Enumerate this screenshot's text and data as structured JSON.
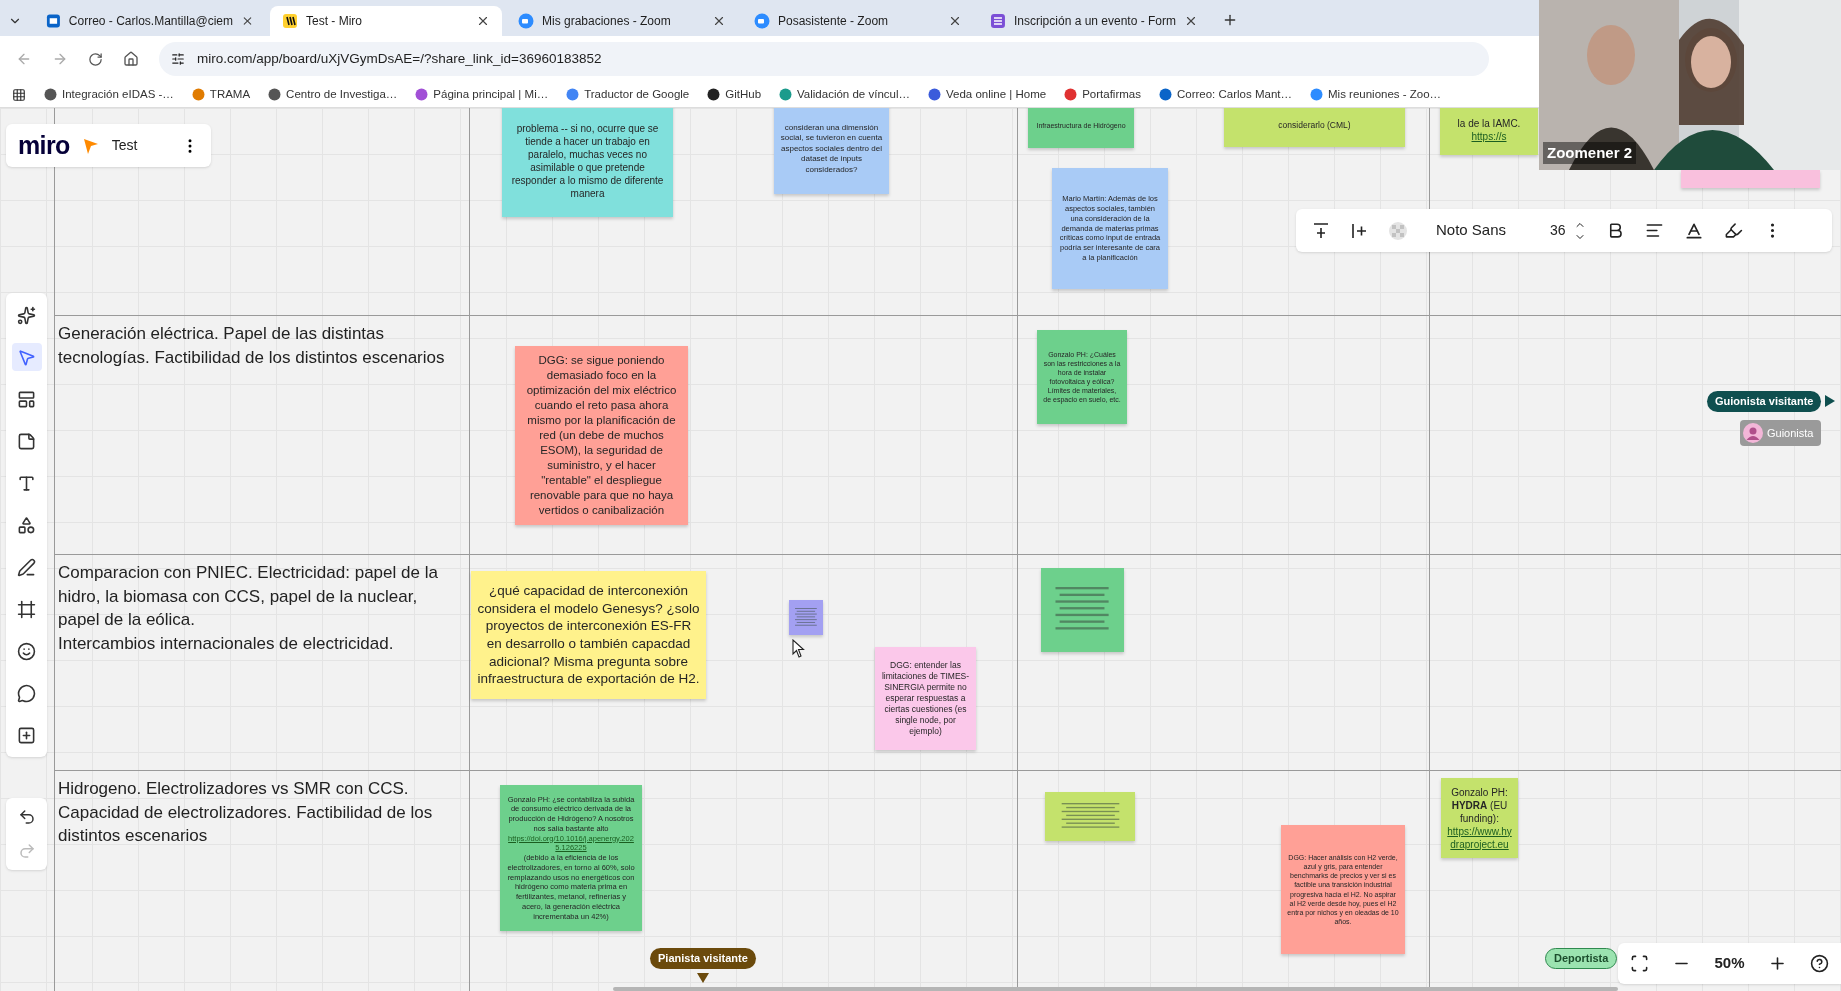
{
  "browser": {
    "tabs": [
      {
        "title": "Correo - Carlos.Mantilla@ciem",
        "kind": "mail",
        "selected": false
      },
      {
        "title": "Test - Miro",
        "kind": "miro",
        "selected": true
      },
      {
        "title": "Mis grabaciones - Zoom",
        "kind": "zoom",
        "selected": false
      },
      {
        "title": "Posasistente - Zoom",
        "kind": "zoom",
        "selected": false
      },
      {
        "title": "Inscripción a un evento - Form",
        "kind": "forms",
        "selected": false
      }
    ],
    "address": "miro.com/app/board/uXjVGymDsAE=/?share_link_id=36960183852",
    "bookmarks": [
      "Integración eIDAS -…",
      "TRAMA",
      "Centro de Investiga…",
      "Página principal | Mi…",
      "Traductor de Google",
      "GitHub",
      "Validación de víncul…",
      "Veda online | Home",
      "Portafirmas",
      "Correo: Carlos Mant…",
      "Mis reuniones - Zoo…"
    ]
  },
  "board": {
    "logo": "miro",
    "name": "Test",
    "rows": [
      {
        "label": "Generación eléctrica. Papel de las distintas tecnologías. Factibilidad de los distintos escenarios"
      },
      {
        "label": "Comparacion con PNIEC. Electricidad: papel de la hidro, la biomasa con CCS, papel de la nuclear, papel de la eólica.\nIntercambios internacionales de electricidad."
      },
      {
        "label": "Hidrogeno. Electrolizadores vs SMR con CCS. Capacidad de electrolizadores. Factibilidad de los distintos escenarios"
      }
    ],
    "notes": [
      {
        "kind": "text",
        "color": "#80e0dc",
        "text": "problema -- si no, ocurre que se tiende a hacer un trabajo en paralelo, muchas veces no asimilable o que pretende responder a lo mismo de diferente manera"
      },
      {
        "kind": "text",
        "color": "#a9cbf6",
        "text": "consideran una dimensión social, se tuvieron en cuenta aspectos sociales dentro del dataset de inputs considerados?"
      },
      {
        "kind": "text",
        "color": "#6dd08c",
        "text": "Infraestructura de Hidrógeno"
      },
      {
        "kind": "text",
        "color": "#a9cbf6",
        "text": "Mario Martín: Además de los aspectos sociales, también una consideración de la demanda de materias primas críticas como input de entrada podría ser interesante de cara a la planificación"
      },
      {
        "kind": "text",
        "color": "#c4e26c",
        "text": "considerarlo (CML)"
      },
      {
        "kind": "text",
        "color": "#c4e26c",
        "text": "la de la IAMC.",
        "link": "https://s"
      },
      {
        "kind": "blank",
        "color": "#f9c0dd"
      },
      {
        "kind": "text",
        "color": "#ffa096",
        "text": "DGG: se sigue poniendo demasiado foco en la optimización del mix eléctrico cuando el reto pasa ahora mismo por la planificación de red (un debe de muchos ESOM), la seguridad de suministro, y el hacer \"rentable\" el despliegue renovable para que no haya vertidos o canibalización"
      },
      {
        "kind": "text",
        "color": "#6dd08c",
        "text": "Gonzalo PH: ¿Cuáles son las restricciones a la hora de instalar fotovoltaica y eólica? Límites de materiales, de espacio en suelo, etc."
      },
      {
        "kind": "text",
        "color": "#fff28c",
        "text": "¿qué capacidad de interconexión considera el modelo Genesys? ¿solo proyectos de interconexión ES-FR en desarrollo o también capacdad adicional? Misma pregunta sobre infraestructura de exportación de H2."
      },
      {
        "kind": "scribble",
        "color": "#a3a0f2"
      },
      {
        "kind": "text",
        "color": "#fbc8ea",
        "text": "DGG: entender las limitaciones de TIMES-SINERGIA permite no esperar respuestas a ciertas cuestiones (es single node, por ejemplo)"
      },
      {
        "kind": "scribble",
        "color": "#6dd08c"
      },
      {
        "kind": "text",
        "color": "#6dd08c",
        "text": "Gonzalo PH: ¿se contabiliza la subida de consumo eléctrico derivada de la producción de Hidrógeno? A nosotros nos salía bastante alto",
        "link": "https://doi.org/10.1016/j.apenergy.2025.126225",
        "text_after": "(debido a la eficiencia de los electrolizadores, en torno al 60%, solo remplazando usos no energéticos con hidrógeno como materia prima en fertilizantes, metanol, refinerías y acero, la generación eléctrica incrementaba un 42%)"
      },
      {
        "kind": "scribble",
        "color": "#c4e26c"
      },
      {
        "kind": "text",
        "color": "#ffa096",
        "text": "DGG: Hacer análisis con H2 verde, azul y gris, para entender benchmarks de precios y ver si es factible una transición industrial progresiva hacia el H2. No aspirar al H2 verde desde hoy, pues el H2 entra por nichos y en oleadas de 10 años."
      },
      {
        "kind": "text",
        "color": "#c4e26c",
        "text": "Gonzalo PH: **HYDRA** (EU funding):",
        "link": "https://www.hydraproject.eu"
      }
    ],
    "collaborators": [
      {
        "name": "Guionista visitante",
        "kind": "badge-right",
        "color": "#0f4f4f"
      },
      {
        "name": "Guionista",
        "kind": "chip",
        "color": "#9a9a9a"
      },
      {
        "name": "Pianista visitante",
        "kind": "badge-down",
        "color": "#6b4a0c"
      },
      {
        "name": "Deportista",
        "kind": "badge-plain",
        "color": "#9be3b0"
      }
    ]
  },
  "tools": [
    {
      "kind": "ai",
      "selected": false
    },
    {
      "kind": "select",
      "selected": true
    },
    {
      "kind": "templates",
      "selected": false
    },
    {
      "kind": "sticky",
      "selected": false
    },
    {
      "kind": "text",
      "selected": false
    },
    {
      "kind": "shapes",
      "selected": false
    },
    {
      "kind": "pen",
      "selected": false
    },
    {
      "kind": "frame",
      "selected": false
    },
    {
      "kind": "stickers",
      "selected": false
    },
    {
      "kind": "comment",
      "selected": false
    },
    {
      "kind": "more",
      "selected": false
    }
  ],
  "text_toolbar": {
    "font": "Noto Sans",
    "size": "36"
  },
  "zoom": {
    "level_text": "50%"
  },
  "video": {
    "name": "Zoomener 2"
  }
}
